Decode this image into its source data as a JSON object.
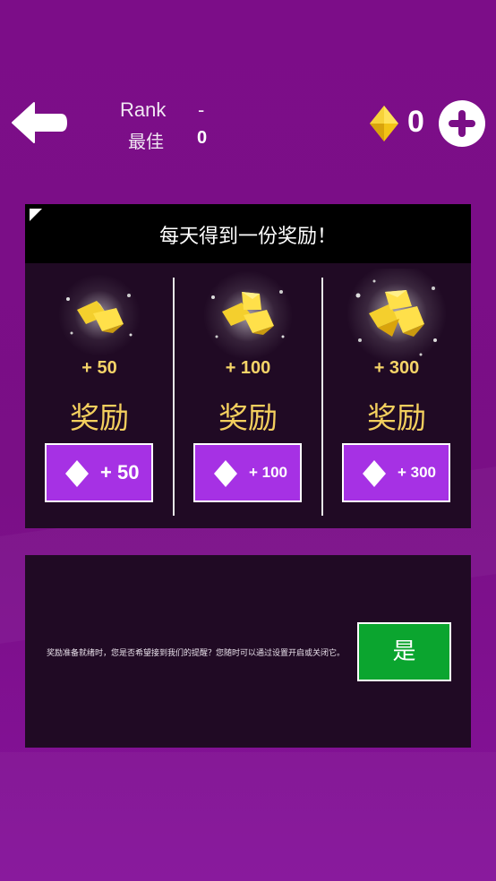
{
  "header": {
    "rank_label": "Rank",
    "rank_value": "-",
    "best_label": "最佳",
    "best_value": "0",
    "gem_count": "0"
  },
  "reward_panel": {
    "title": "每天得到一份奖励！",
    "items": [
      {
        "amount_label": "+ 50",
        "reward_word": "奖励",
        "button_label": "+ 50"
      },
      {
        "amount_label": "+ 100",
        "reward_word": "奖励",
        "button_label": "+ 100"
      },
      {
        "amount_label": "+ 300",
        "reward_word": "奖励",
        "button_label": "+ 300"
      }
    ]
  },
  "notify_panel": {
    "message": "奖励准备就绪时，您是否希望接到我们的提醒？您随时可以通过设置开启或关闭它。",
    "yes_label": "是"
  },
  "icons": {
    "back": "back-arrow-icon",
    "gem": "gem-icon",
    "add": "plus-icon",
    "gold": "gold-nuggets-icon"
  },
  "colors": {
    "background": "#7a0f86",
    "panel": "#200a24",
    "claim_button": "#a631e4",
    "yes_button": "#0ba52f",
    "reward_text": "#f3cf5e"
  }
}
